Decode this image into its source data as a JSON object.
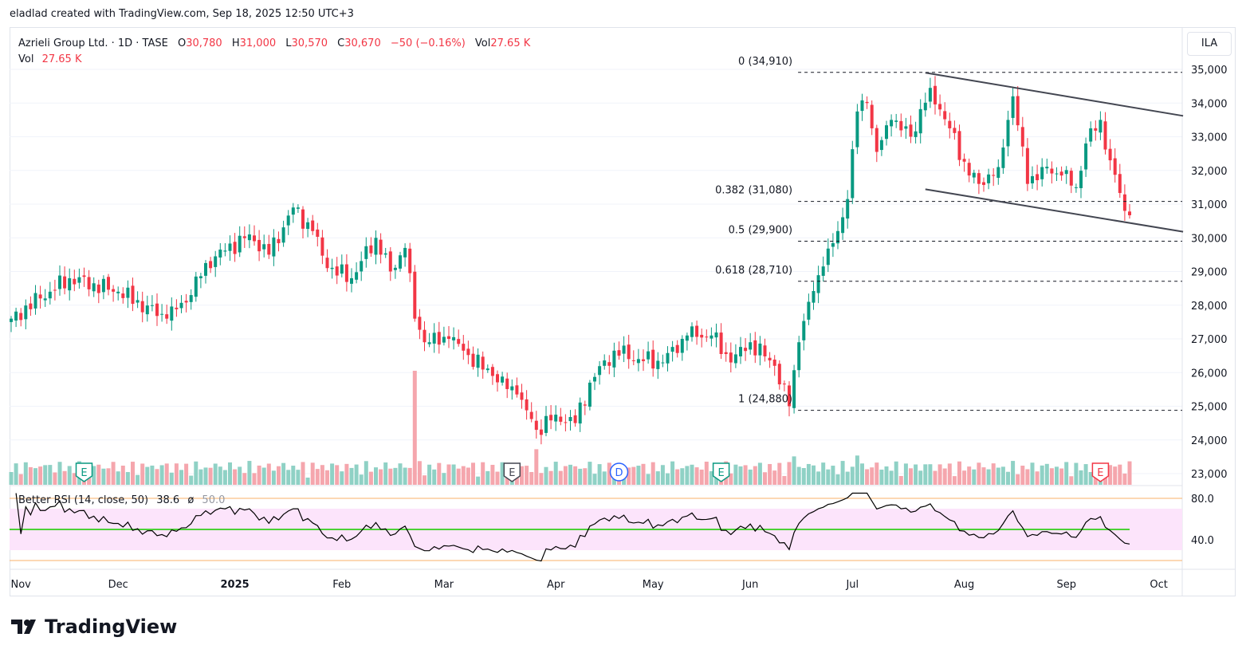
{
  "credit": "eladlad created with TradingView.com, Sep 18, 2025 12:50 UTC+3",
  "legend": {
    "symbol": "Azrieli Group Ltd. · 1D · TASE",
    "o_label": "O",
    "o": "30,780",
    "h_label": "H",
    "h": "31,000",
    "l_label": "L",
    "l": "30,570",
    "c_label": "C",
    "c": "30,670",
    "change": "−50 (−0.16%)",
    "vol_label": "Vol",
    "vol": "27.65 K",
    "vol2_label": "Vol",
    "vol2": "27.65 K"
  },
  "rsi_legend": {
    "name": "Better RSI (14, close, 50)",
    "value": "38.6",
    "symbol": "ø",
    "mid": "50.0"
  },
  "currency": "ILA",
  "logo": "TradingView",
  "colors": {
    "up": "#089981",
    "down": "#f23645",
    "up_vol": "#8fd1c5",
    "down_vol": "#f5a6ad",
    "rsi_band": "#fce4fb",
    "rsi_ref": "#f8b26a",
    "rsi_mid": "#4cd137"
  },
  "chart_data": {
    "type": "candlestick",
    "title": "Azrieli Group Ltd. · 1D · TASE",
    "ylim": [
      23000,
      35000
    ],
    "y_ticks": [
      "35,000",
      "34,000",
      "33,000",
      "32,000",
      "31,000",
      "30,000",
      "29,000",
      "28,000",
      "27,000",
      "26,000",
      "25,000",
      "24,000",
      "23,000"
    ],
    "y_tick_values": [
      35000,
      34000,
      33000,
      32000,
      31000,
      30000,
      29000,
      28000,
      27000,
      26000,
      25000,
      24000,
      23000
    ],
    "x_ticks": [
      {
        "label": "Nov",
        "day": 2,
        "bold": false
      },
      {
        "label": "Dec",
        "day": 22,
        "bold": false
      },
      {
        "label": "2025",
        "day": 46,
        "bold": true
      },
      {
        "label": "Feb",
        "day": 68,
        "bold": false
      },
      {
        "label": "Mar",
        "day": 89,
        "bold": false
      },
      {
        "label": "Apr",
        "day": 112,
        "bold": false
      },
      {
        "label": "May",
        "day": 132,
        "bold": false
      },
      {
        "label": "Jun",
        "day": 152,
        "bold": false
      },
      {
        "label": "Jul",
        "day": 173,
        "bold": false
      },
      {
        "label": "Aug",
        "day": 196,
        "bold": false
      },
      {
        "label": "Sep",
        "day": 217,
        "bold": false
      },
      {
        "label": "Oct",
        "day": 236,
        "bold": false
      }
    ],
    "close_keypoints": [
      [
        0,
        27600
      ],
      [
        6,
        28200
      ],
      [
        12,
        28800
      ],
      [
        22,
        28400
      ],
      [
        32,
        27600
      ],
      [
        37,
        28300
      ],
      [
        40,
        29250
      ],
      [
        49,
        30100
      ],
      [
        53,
        29500
      ],
      [
        58,
        30900
      ],
      [
        62,
        30200
      ],
      [
        65,
        29100
      ],
      [
        70,
        28800
      ],
      [
        75,
        30000
      ],
      [
        78,
        29000
      ],
      [
        81,
        29700
      ],
      [
        83,
        27600
      ],
      [
        85,
        26900
      ],
      [
        90,
        27000
      ],
      [
        93,
        26650
      ],
      [
        99,
        25900
      ],
      [
        104,
        25350
      ],
      [
        108,
        24300
      ],
      [
        112,
        24750
      ],
      [
        116,
        24500
      ],
      [
        119,
        25700
      ],
      [
        124,
        26650
      ],
      [
        129,
        26400
      ],
      [
        134,
        26300
      ],
      [
        139,
        27100
      ],
      [
        144,
        27100
      ],
      [
        148,
        26300
      ],
      [
        152,
        26900
      ],
      [
        157,
        26200
      ],
      [
        160,
        25000
      ],
      [
        162,
        26900
      ],
      [
        164,
        28100
      ],
      [
        167,
        29150
      ],
      [
        170,
        30200
      ],
      [
        172,
        31150
      ],
      [
        174,
        33750
      ],
      [
        176,
        34000
      ],
      [
        178,
        32550
      ],
      [
        181,
        33500
      ],
      [
        185,
        33000
      ],
      [
        189,
        34450
      ],
      [
        193,
        33250
      ],
      [
        197,
        31850
      ],
      [
        199,
        31600
      ],
      [
        203,
        32100
      ],
      [
        206,
        34200
      ],
      [
        209,
        31600
      ],
      [
        212,
        32100
      ],
      [
        216,
        31850
      ],
      [
        219,
        31500
      ],
      [
        221,
        32800
      ],
      [
        224,
        33500
      ],
      [
        226,
        32300
      ],
      [
        229,
        30800
      ]
    ],
    "last_bar": {
      "open": 30780,
      "high": 31000,
      "low": 30570,
      "close": 30670,
      "volume_k": 27.65
    },
    "fib_levels": [
      {
        "label": "0 (34,910)",
        "price": 34910
      },
      {
        "label": "0.382 (31,080)",
        "price": 31080
      },
      {
        "label": "0.5 (29,900)",
        "price": 29900
      },
      {
        "label": "0.618 (28,710)",
        "price": 28710
      },
      {
        "label": "1 (24,880)",
        "price": 24880
      }
    ],
    "fib_start_day": 161,
    "channel": {
      "upper": [
        [
          188,
          34900
        ],
        [
          241,
          33620
        ]
      ],
      "lower": [
        [
          188,
          31440
        ],
        [
          241,
          30180
        ]
      ]
    },
    "events": [
      {
        "label": "E",
        "day": 15,
        "type": "earnings-past"
      },
      {
        "label": "E",
        "day": 103,
        "type": "earnings-past"
      },
      {
        "label": "D",
        "day": 125,
        "type": "dividend"
      },
      {
        "label": "E",
        "day": 146,
        "type": "earnings-past"
      },
      {
        "label": "E",
        "day": 224,
        "type": "earnings-upcoming"
      }
    ],
    "rsi": {
      "period": 14,
      "ylim": [
        0,
        100
      ],
      "ticks": [
        "80.0",
        "40.0"
      ],
      "tick_values": [
        80,
        40
      ],
      "band": [
        30,
        70
      ],
      "ref_lines": [
        80,
        20
      ],
      "mid": 50
    }
  }
}
